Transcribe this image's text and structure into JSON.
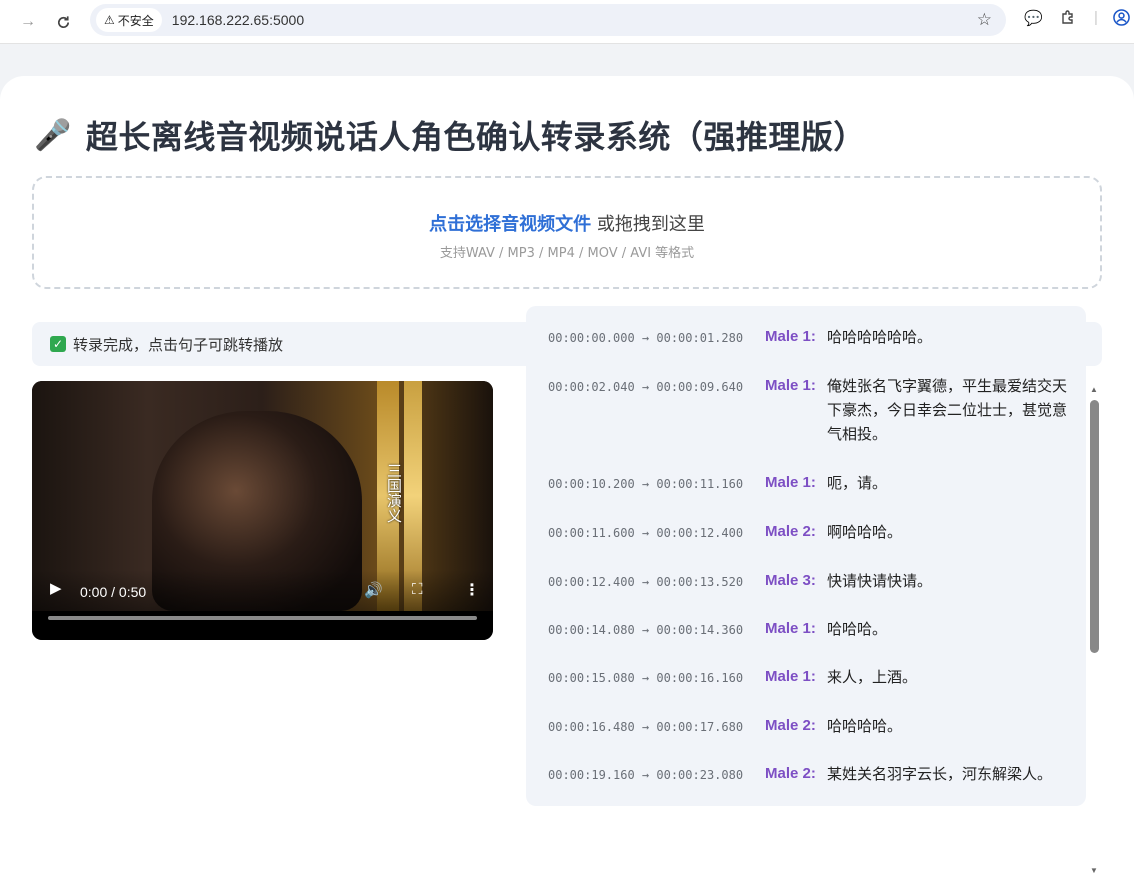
{
  "browser": {
    "security_label": "不安全",
    "url": "192.168.222.65:5000"
  },
  "page": {
    "title": "超长离线音视频说话人角色确认转录系统（强推理版）",
    "title_icon": "microphone-icon",
    "dropzone": {
      "link_text": "点击选择音视频文件",
      "rest_text": " 或拖拽到这里",
      "formats": "支持WAV / MP3 / MP4 / MOV / AVI 等格式"
    },
    "status": "转录完成，点击句子可跳转播放",
    "video": {
      "time": "0:00 / 0:50",
      "subtitle": "三国演义",
      "progress": 0.0
    },
    "segments": [
      {
        "time": "00:00:00.000 → 00:00:01.280",
        "speaker": "Male 1:",
        "text": "哈哈哈哈哈哈。"
      },
      {
        "time": "00:00:02.040 → 00:00:09.640",
        "speaker": "Male 1:",
        "text": "俺姓张名飞字翼德，平生最爱结交天下豪杰，今日幸会二位壮士，甚觉意气相投。"
      },
      {
        "time": "00:00:10.200 → 00:00:11.160",
        "speaker": "Male 1:",
        "text": "呃，请。"
      },
      {
        "time": "00:00:11.600 → 00:00:12.400",
        "speaker": "Male 2:",
        "text": "啊哈哈哈。"
      },
      {
        "time": "00:00:12.400 → 00:00:13.520",
        "speaker": "Male 3:",
        "text": "快请快请快请。"
      },
      {
        "time": "00:00:14.080 → 00:00:14.360",
        "speaker": "Male 1:",
        "text": "哈哈哈。"
      },
      {
        "time": "00:00:15.080 → 00:00:16.160",
        "speaker": "Male 1:",
        "text": "来人，上酒。"
      },
      {
        "time": "00:00:16.480 → 00:00:17.680",
        "speaker": "Male 2:",
        "text": "哈哈哈哈。"
      },
      {
        "time": "00:00:19.160 → 00:00:23.080",
        "speaker": "Male 2:",
        "text": "某姓关名羽字云长，河东解梁人。"
      }
    ]
  },
  "colors": {
    "accent_link": "#2f6fd6",
    "speaker": "#7d4fc4",
    "status_check": "#2fa84f"
  }
}
